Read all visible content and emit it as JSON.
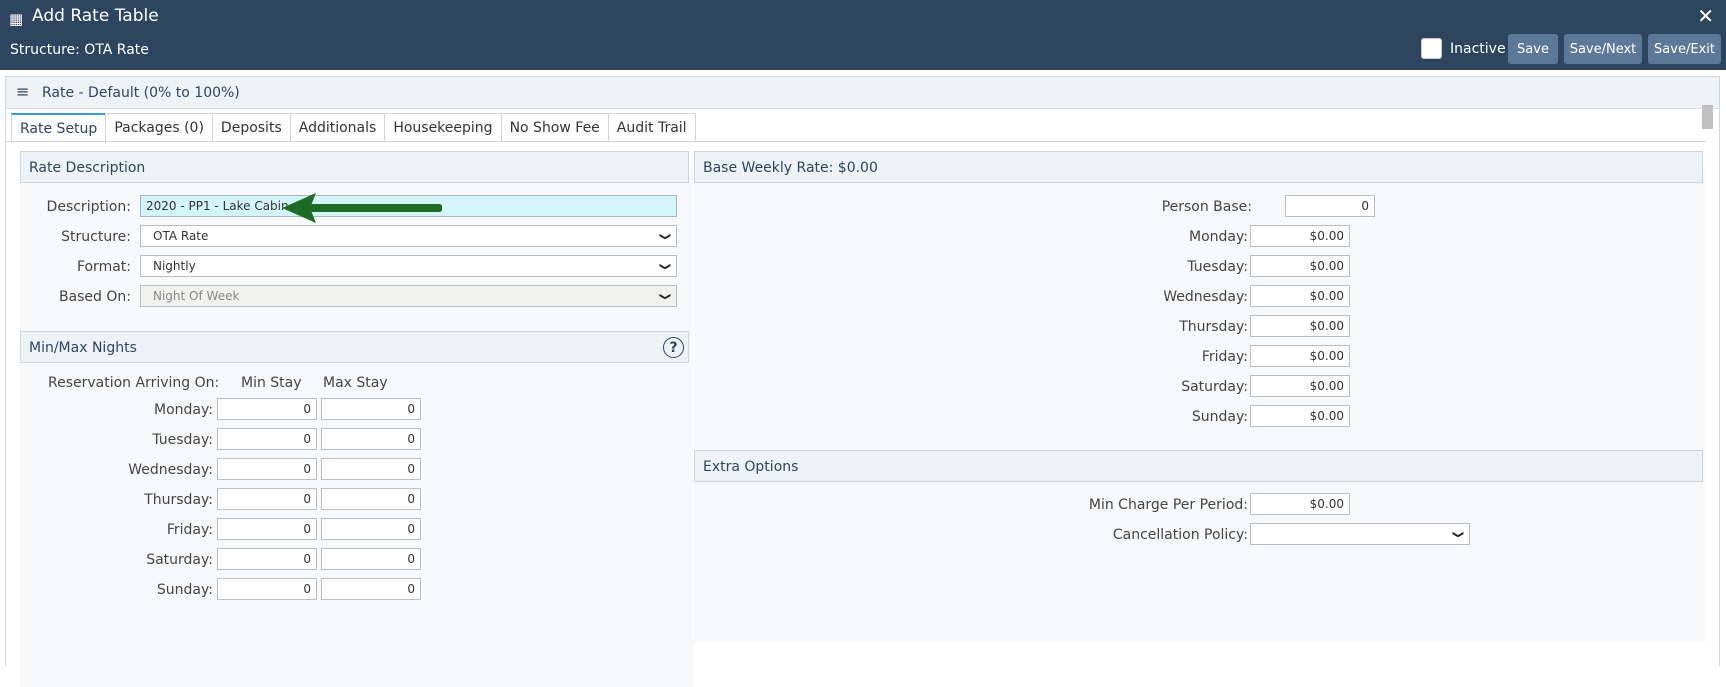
{
  "window": {
    "title": "Add Rate Table",
    "structure_label": "Structure: OTA Rate",
    "inactive_label": "Inactive",
    "buttons": {
      "save": "Save",
      "save_next": "Save/Next",
      "save_exit": "Save/Exit"
    },
    "close_glyph": "✕",
    "calendar_glyph": "▦"
  },
  "panel": {
    "title": "Rate - Default (0% to 100%)",
    "menu_glyph": "≡"
  },
  "tabs": [
    {
      "label": "Rate Setup",
      "active": true
    },
    {
      "label": "Packages (0)"
    },
    {
      "label": "Deposits"
    },
    {
      "label": "Additionals"
    },
    {
      "label": "Housekeeping"
    },
    {
      "label": "No Show Fee"
    },
    {
      "label": "Audit Trail"
    }
  ],
  "rate_description": {
    "title": "Rate Description",
    "description_label": "Description:",
    "description_value": "2020 - PP1 - Lake Cabin",
    "structure_label": "Structure:",
    "structure_value": "OTA Rate",
    "format_label": "Format:",
    "format_value": "Nightly",
    "based_on_label": "Based On:",
    "based_on_value": "Night Of Week"
  },
  "min_max": {
    "title": "Min/Max Nights",
    "help_glyph": "?",
    "arriving_label": "Reservation Arriving On:",
    "min_label": "Min Stay",
    "max_label": "Max Stay",
    "days": [
      {
        "day": "Monday:",
        "min": "0",
        "max": "0"
      },
      {
        "day": "Tuesday:",
        "min": "0",
        "max": "0"
      },
      {
        "day": "Wednesday:",
        "min": "0",
        "max": "0"
      },
      {
        "day": "Thursday:",
        "min": "0",
        "max": "0"
      },
      {
        "day": "Friday:",
        "min": "0",
        "max": "0"
      },
      {
        "day": "Saturday:",
        "min": "0",
        "max": "0"
      },
      {
        "day": "Sunday:",
        "min": "0",
        "max": "0"
      }
    ]
  },
  "base_weekly": {
    "title": "Base Weekly Rate: $0.00",
    "person_base_label": "Person Base:",
    "person_base_value": "0",
    "days": [
      {
        "day": "Monday:",
        "rate": "$0.00"
      },
      {
        "day": "Tuesday:",
        "rate": "$0.00"
      },
      {
        "day": "Wednesday:",
        "rate": "$0.00"
      },
      {
        "day": "Thursday:",
        "rate": "$0.00"
      },
      {
        "day": "Friday:",
        "rate": "$0.00"
      },
      {
        "day": "Saturday:",
        "rate": "$0.00"
      },
      {
        "day": "Sunday:",
        "rate": "$0.00"
      }
    ]
  },
  "extra_options": {
    "title": "Extra Options",
    "min_charge_label": "Min Charge Per Period:",
    "min_charge_value": "$0.00",
    "cancellation_label": "Cancellation Policy:",
    "cancellation_value": ""
  },
  "colors": {
    "header_bg": "#2e4560",
    "button_bg": "#5c7a97",
    "arrow": "#1e6b25",
    "description_bg": "#d4f5f8"
  }
}
